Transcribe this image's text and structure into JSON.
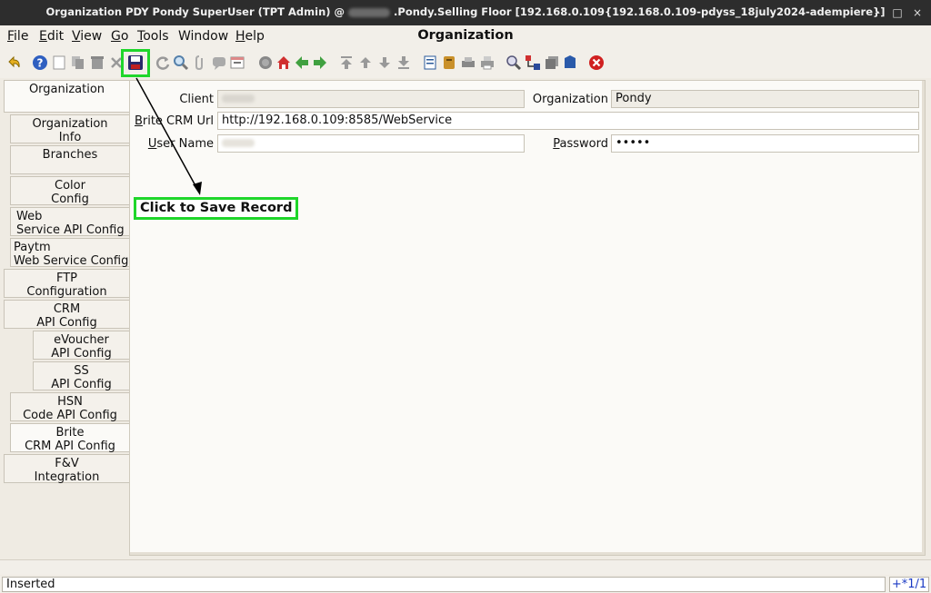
{
  "window": {
    "title_prefix": "Organization  PDY  Pondy  SuperUser (TPT Admin) @",
    "title_suffix": ".Pondy.Selling Floor [192.168.0.109{192.168.0.109-pdyss_18july2024-adempiere}]",
    "minimize_glyph": "–",
    "maximize_glyph": "□",
    "close_glyph": "×"
  },
  "menubar": {
    "items": [
      {
        "hotkey": "F",
        "rest": "ile"
      },
      {
        "hotkey": "E",
        "rest": "dit"
      },
      {
        "hotkey": "V",
        "rest": "iew"
      },
      {
        "hotkey": "G",
        "rest": "o"
      },
      {
        "hotkey": "T",
        "rest": "ools"
      },
      {
        "hotkey": "",
        "rest": "Window"
      },
      {
        "hotkey": "H",
        "rest": "elp"
      }
    ],
    "window_title": "Organization"
  },
  "annotation": {
    "callout": "Click to Save Record"
  },
  "tabs": [
    {
      "label": "Organization"
    },
    {
      "label": "Organization\nInfo"
    },
    {
      "label": "Branches"
    },
    {
      "label": "Color\nConfig"
    },
    {
      "label": "Web\nService API Config"
    },
    {
      "label": "Paytm\nWeb Service Config"
    },
    {
      "label": "FTP\nConfiguration"
    },
    {
      "label": "CRM\nAPI Config"
    },
    {
      "label": "eVoucher\nAPI Config"
    },
    {
      "label": "SS\nAPI Config"
    },
    {
      "label": "HSN\nCode API Config"
    },
    {
      "label": "Brite\nCRM API Config"
    },
    {
      "label": "F&V\nIntegration"
    }
  ],
  "form": {
    "client_label": "Client",
    "organization_label": "Organization",
    "organization_value": "Pondy",
    "crm_url_label_hotkey": "B",
    "crm_url_label_rest": "rite CRM Url",
    "crm_url_value": "http://192.168.0.109:8585/WebService",
    "username_label_hotkey": "U",
    "username_label_rest": "ser Name",
    "password_label_hotkey": "P",
    "password_label_rest": "assword",
    "password_value": "•••••"
  },
  "status": {
    "message": "Inserted",
    "record_count": "+*1/1"
  },
  "colors": {
    "highlight": "#1fd62b",
    "title_bg": "#2d2d2d"
  }
}
